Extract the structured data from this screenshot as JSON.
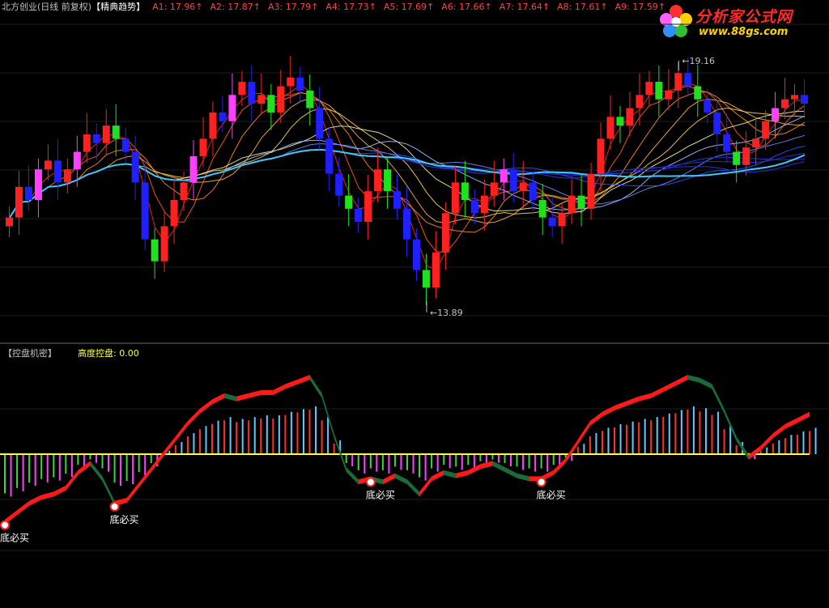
{
  "header": {
    "stock": "北方创业(日线 前复权)",
    "indicator": "【精典趋势】",
    "averages": [
      "A1: 17.96",
      "A2: 17.87",
      "A3: 17.79",
      "A4: 17.73",
      "A5: 17.69",
      "A6: 17.66",
      "A7: 17.64",
      "A8: 17.61",
      "A9: 17.59"
    ],
    "lower_title": "【控盘机密】",
    "lower_value_label": "高度控盘: 0.00"
  },
  "logo": {
    "name": "分析家公式网",
    "url": "www.88gs.com"
  },
  "colors": {
    "up": "#ff2020",
    "down": "#2020ff",
    "up_alt": "#ff40ff",
    "down_alt": "#20e020",
    "flat": "#ffff00",
    "zero_line": "#ffff40",
    "curve_rise": "#ff1a1a",
    "curve_fall": "#1a6a3a"
  },
  "chart_data": [
    {
      "type": "candlestick",
      "title": "北方创业(日线 前复权)",
      "annotations": [
        {
          "label": "19.16",
          "value": 19.16,
          "kind": "max"
        },
        {
          "label": "13.89",
          "value": 13.89,
          "kind": "min"
        }
      ],
      "ylim": [
        13.0,
        20.4
      ],
      "grid": true,
      "moving_averages_legend": [
        "A1",
        "A2",
        "A3",
        "A4",
        "A5",
        "A6",
        "A7",
        "A8",
        "A9"
      ],
      "closes": [
        15.8,
        16.5,
        16.2,
        16.9,
        17.1,
        16.6,
        16.9,
        17.3,
        17.7,
        17.5,
        17.9,
        17.6,
        17.3,
        16.6,
        15.3,
        14.8,
        15.6,
        16.2,
        16.6,
        17.2,
        17.6,
        18.2,
        18.0,
        18.6,
        18.9,
        18.4,
        18.6,
        18.2,
        18.8,
        19.0,
        18.7,
        18.3,
        17.6,
        16.8,
        16.3,
        16.0,
        15.7,
        16.4,
        16.9,
        16.4,
        16.0,
        15.3,
        14.6,
        14.2,
        15.0,
        15.9,
        16.6,
        16.2,
        15.9,
        16.3,
        16.6,
        16.9,
        16.4,
        16.6,
        16.2,
        15.8,
        15.6,
        15.9,
        16.3,
        16.0,
        16.8,
        17.6,
        18.1,
        17.9,
        18.3,
        18.6,
        18.9,
        18.5,
        18.7,
        19.1,
        18.8,
        18.5,
        18.2,
        17.7,
        17.3,
        17.0,
        17.4,
        17.6,
        18.0,
        18.3,
        18.5,
        18.6,
        18.4
      ]
    },
    {
      "type": "oscillator",
      "title": "【控盘机密】",
      "series": [
        {
          "name": "高度控盘",
          "values": [
            0.0
          ]
        }
      ],
      "curve": [
        -2.2,
        -1.9,
        -1.6,
        -1.4,
        -1.3,
        -1.1,
        -0.6,
        -0.3,
        -0.8,
        -1.6,
        -1.5,
        -1.0,
        -0.5,
        0.0,
        0.5,
        1.0,
        1.4,
        1.7,
        1.9,
        1.8,
        1.9,
        2.0,
        2.0,
        2.2,
        2.35,
        2.5,
        1.9,
        0.6,
        -0.5,
        -0.9,
        -0.8,
        -0.9,
        -0.7,
        -0.9,
        -1.3,
        -0.8,
        -0.6,
        -0.7,
        -0.6,
        -0.4,
        -0.3,
        -0.5,
        -0.7,
        -0.8,
        -0.8,
        -0.6,
        -0.2,
        0.4,
        1.0,
        1.3,
        1.5,
        1.65,
        1.8,
        1.9,
        2.1,
        2.3,
        2.5,
        2.4,
        2.2,
        1.4,
        0.5,
        -0.1,
        0.2,
        0.6,
        0.9,
        1.1,
        1.3
      ],
      "buy_signals": [
        {
          "index": 0,
          "label": "底必买"
        },
        {
          "index": 9,
          "label": "底必买"
        },
        {
          "index": 30,
          "label": "底必买"
        },
        {
          "index": 44,
          "label": "底必买"
        }
      ],
      "zero_line": 0.0
    }
  ]
}
